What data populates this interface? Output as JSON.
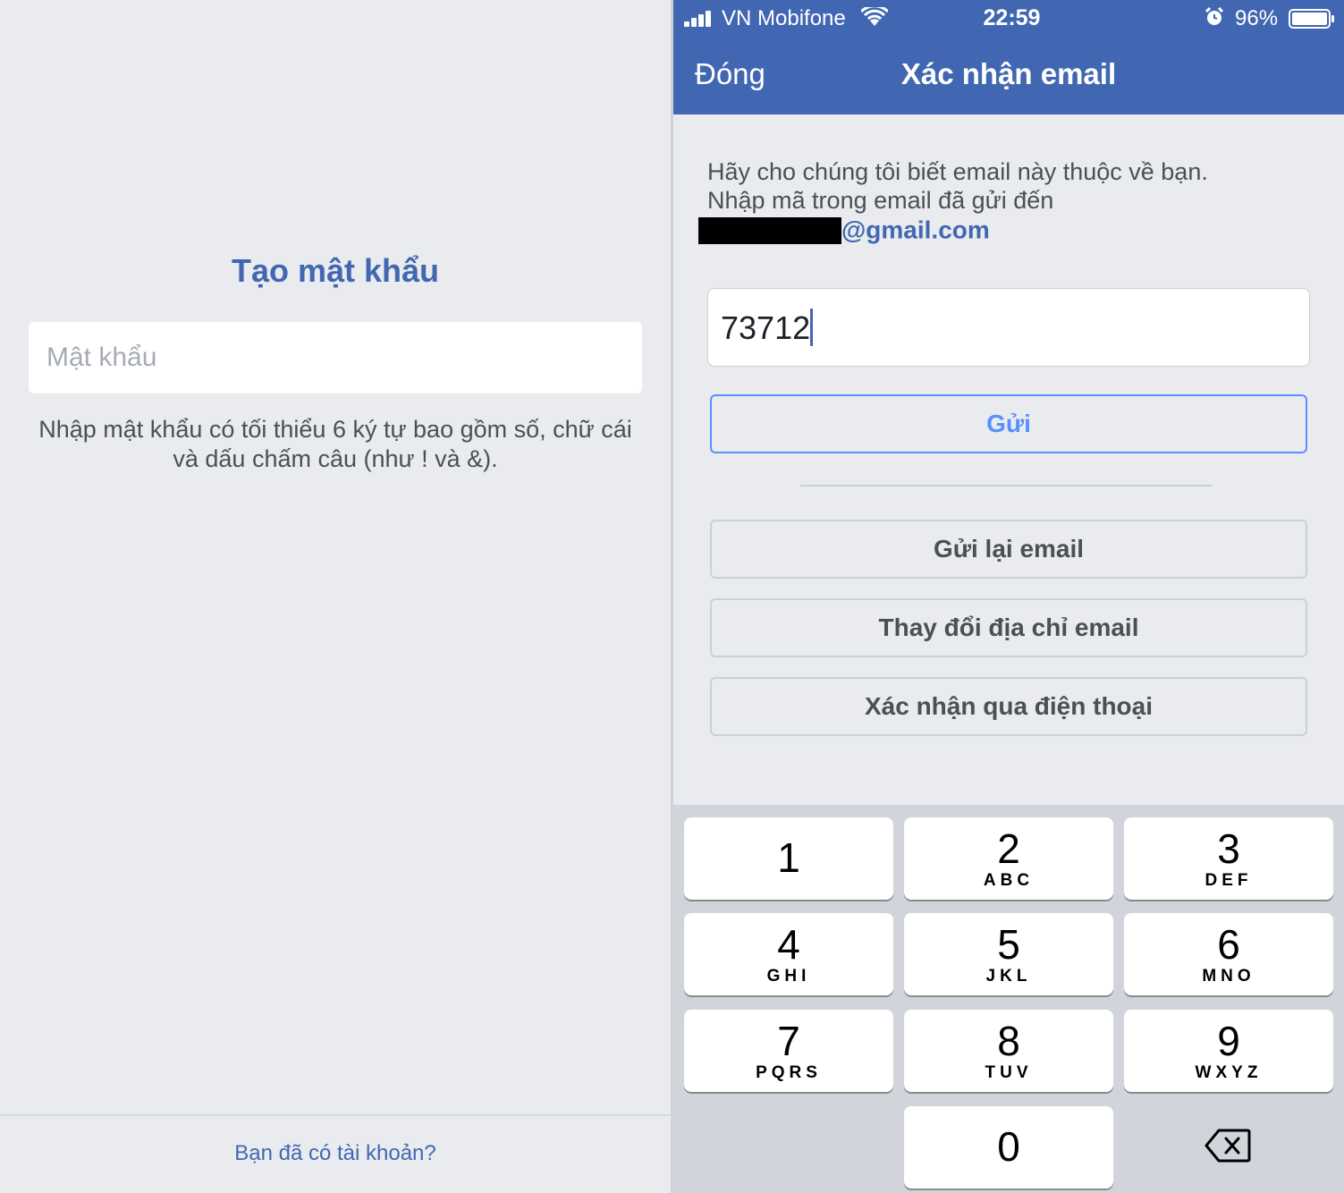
{
  "left": {
    "title": "Tạo mật khẩu",
    "password_placeholder": "Mật khẩu",
    "hint": "Nhập mật khẩu có tối thiểu 6 ký tự bao gồm số, chữ cái và dấu chấm câu (như ! và &).",
    "login_link": "Bạn đã có tài khoản?"
  },
  "status_bar": {
    "carrier": "VN Mobifone",
    "time": "22:59",
    "battery": "96%"
  },
  "nav": {
    "close": "Đóng",
    "title": "Xác nhận email"
  },
  "info": {
    "line1": "Hãy cho chúng tôi biết email này thuộc về bạn.",
    "line2": "Nhập mã trong email đã gửi đến",
    "email_domain": "@gmail.com"
  },
  "code": {
    "value": "73712"
  },
  "buttons": {
    "send": "Gửi",
    "resend": "Gửi lại email",
    "change_email": "Thay đổi địa chỉ email",
    "confirm_phone": "Xác nhận qua điện thoại"
  },
  "keypad": [
    {
      "num": "1",
      "letters": ""
    },
    {
      "num": "2",
      "letters": "ABC"
    },
    {
      "num": "3",
      "letters": "DEF"
    },
    {
      "num": "4",
      "letters": "GHI"
    },
    {
      "num": "5",
      "letters": "JKL"
    },
    {
      "num": "6",
      "letters": "MNO"
    },
    {
      "num": "7",
      "letters": "PQRS"
    },
    {
      "num": "8",
      "letters": "TUV"
    },
    {
      "num": "9",
      "letters": "WXYZ"
    },
    {
      "num": "0",
      "letters": ""
    }
  ],
  "colors": {
    "brand": "#4267b2",
    "accent": "#5890ff",
    "background": "#e9ebee"
  }
}
